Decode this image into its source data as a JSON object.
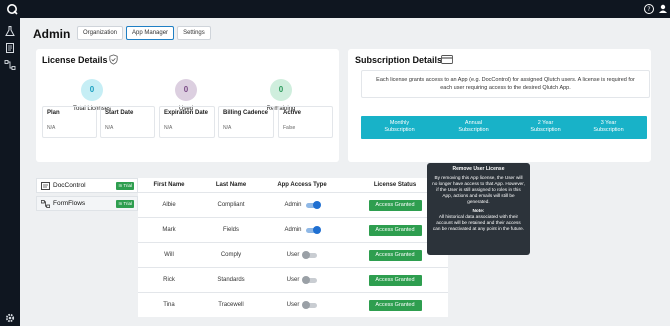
{
  "page": {
    "title": "Admin"
  },
  "tabs": [
    "Organization",
    "App Manager",
    "Settings"
  ],
  "license": {
    "title": "License Details",
    "stats": [
      {
        "value": "0",
        "label": "Total Licenses",
        "color": "#c6eef5",
        "textColor": "#1a9fc0"
      },
      {
        "value": "0",
        "label": "Used",
        "color": "#dccfe0",
        "textColor": "#7a4a86"
      },
      {
        "value": "0",
        "label": "Remaining",
        "color": "#cfeedd",
        "textColor": "#2b9a5b"
      }
    ],
    "fields": [
      {
        "label": "Plan",
        "value": "N/A"
      },
      {
        "label": "Start Date",
        "value": "N/A"
      },
      {
        "label": "Expiration Date",
        "value": "N/A"
      },
      {
        "label": "Billing Cadence",
        "value": "N/A"
      },
      {
        "label": "Active",
        "value": "False"
      }
    ]
  },
  "subscription": {
    "title": "Subscription Details",
    "description": "Each license grants access to an App (e.g. DocControl) for assigned Qlutch users. A license is required for each user requiring access to the desired Qlutch App.",
    "buttons": [
      {
        "line1": "Monthly",
        "line2": "Subscription"
      },
      {
        "line1": "Annual",
        "line2": "Subscription"
      },
      {
        "line1": "2 Year",
        "line2": "Subscription"
      },
      {
        "line1": "3 Year",
        "line2": "Subscription"
      }
    ]
  },
  "tooltip": {
    "title": "Remove User License",
    "body": "By removing this App license, the User will no longer have access to that App. However, if the User is still assigned to roles in this App, actions and emails will still be generated.",
    "note_title": "Note:",
    "note_body": "All historical data associated with their account will be retained and their access can be reactivated at any point in the future."
  },
  "apps": [
    {
      "name": "DocControl",
      "badge": "In Trial"
    },
    {
      "name": "FormFlows",
      "badge": "In Trial"
    }
  ],
  "table": {
    "headers": [
      "First Name",
      "Last Name",
      "App Access Type",
      "License Status"
    ],
    "rows": [
      {
        "first": "Albie",
        "last": "Compliant",
        "access": "Admin",
        "on": true,
        "status": "Access Granted"
      },
      {
        "first": "Mark",
        "last": "Fields",
        "access": "Admin",
        "on": true,
        "status": "Access Granted"
      },
      {
        "first": "Will",
        "last": "Comply",
        "access": "User",
        "on": false,
        "status": "Access Granted"
      },
      {
        "first": "Rick",
        "last": "Standards",
        "access": "User",
        "on": false,
        "status": "Access Granted"
      },
      {
        "first": "Tina",
        "last": "Tracewell",
        "access": "User",
        "on": false,
        "status": "Access Granted"
      }
    ]
  }
}
